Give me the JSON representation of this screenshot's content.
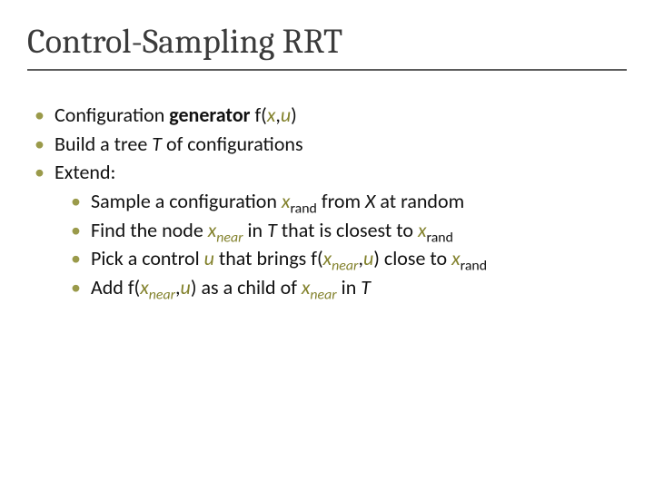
{
  "title": "Control-Sampling RRT",
  "bullets": {
    "b1": {
      "pre": "Configuration ",
      "bold": "generator",
      "post": " f(",
      "v1": "x",
      "comma": ",",
      "v2": "u",
      "close": ")"
    },
    "b2": {
      "pre": "Build a tree ",
      "T": "T",
      "post": " of configurations"
    },
    "b3": {
      "label": "Extend:"
    },
    "s1": {
      "t1": "Sample a configuration ",
      "xvar": "x",
      "xsub": "rand",
      "t2": " from ",
      "X": "X",
      "t3": " at random"
    },
    "s2": {
      "t1": "Find the node ",
      "xvar1": "x",
      "xsub1": "near",
      "t2": " in ",
      "T": "T",
      "t3": " that is closest to ",
      "xvar2": "x",
      "xsub2": "rand"
    },
    "s3": {
      "t1": "Pick a control ",
      "u": "u",
      "t2": " that brings f(",
      "xvar1": "x",
      "xsub1": "near",
      "comma": ",",
      "u2": "u",
      "t3": ") close to ",
      "xvar2": "x",
      "xsub2": "rand"
    },
    "s4": {
      "t1": "Add f(",
      "xvar1": "x",
      "xsub1": "near",
      "comma": ",",
      "u": "u",
      "t2": ") as a child of ",
      "xvar2": "x",
      "xsub2": "near",
      "t3": " in ",
      "T": "T"
    }
  }
}
